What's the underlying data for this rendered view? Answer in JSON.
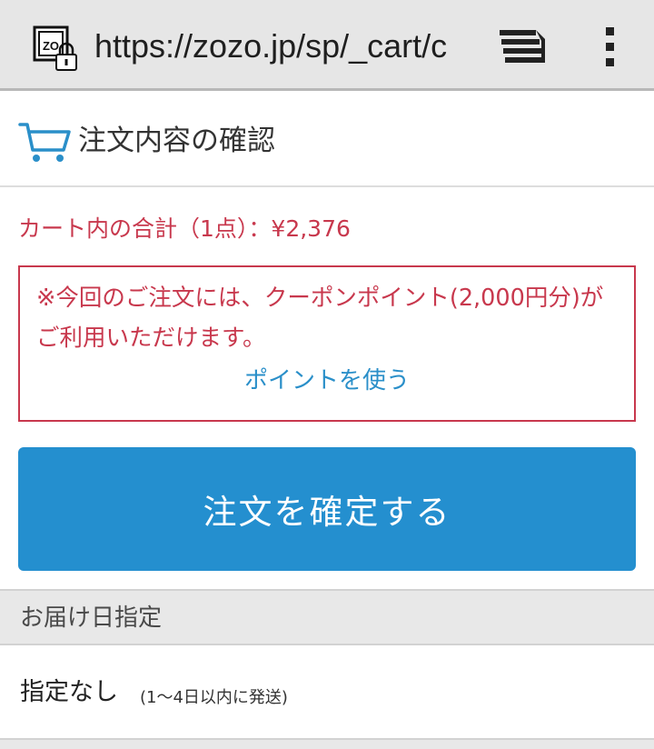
{
  "browser": {
    "url": "https://zozo.jp/sp/_cart/c",
    "site_icon_text": "ZO",
    "colors": {
      "toolbar": "#e6e6e6"
    }
  },
  "header": {
    "title": "注文内容の確認",
    "icon": "cart-icon"
  },
  "cart": {
    "total_text": "カート内の合計（1点）：¥2,376"
  },
  "coupon": {
    "message": "※今回のご注文には、クーポンポイント(2,000円分)がご利用いただけます。",
    "use_points_label": "ポイントを使う"
  },
  "confirm": {
    "label": "注文を確定する"
  },
  "delivery": {
    "section_title": "お届け日指定",
    "selected_value": "指定なし",
    "note": "(1〜4日以内に発送)"
  },
  "colors": {
    "accent_red": "#c8384d",
    "primary_blue": "#248fcf",
    "link_blue": "#2a8fc9"
  }
}
